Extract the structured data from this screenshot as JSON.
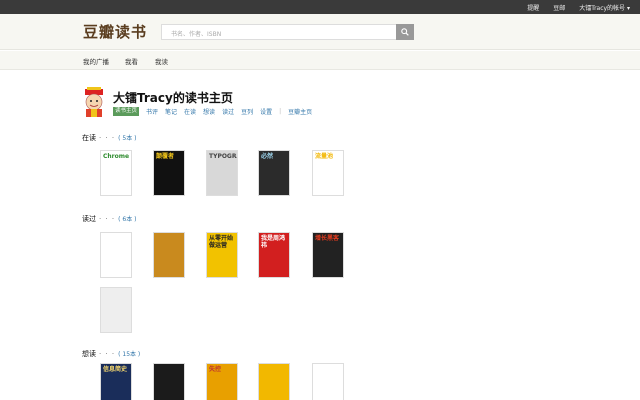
{
  "topbar": {
    "links": [
      "提醒",
      "豆邮"
    ],
    "account_label": "大镭Tracy的帐号",
    "account_caret": "▾"
  },
  "header": {
    "logo": "豆瓣读书",
    "search_placeholder": "书名、作者、ISBN",
    "search_icon": "search-icon"
  },
  "nav": {
    "items": [
      "我的广播",
      "我看",
      "我读"
    ]
  },
  "profile": {
    "title": "大镭Tracy的读书主页",
    "badge": "读书主页",
    "links": [
      "书评",
      "笔记",
      "在读",
      "想读",
      "读过",
      "豆列",
      "设置"
    ],
    "separator": "|",
    "extra_link": "豆瓣主页"
  },
  "sections": [
    {
      "name": "在读",
      "dots": "· · ·",
      "count": "( 5本 )",
      "books": [
        {
          "cover_text": "Chrome",
          "color": "#ffffff",
          "accent": "#2e8b2e"
        },
        {
          "cover_text": "颠覆者",
          "color": "#111111",
          "accent": "#f0c419"
        },
        {
          "cover_text": "TYPOGRAPHY",
          "color": "#d8d8d8",
          "accent": "#444444"
        },
        {
          "cover_text": "必然",
          "color": "#2b2b2b",
          "accent": "#9ad0e8"
        },
        {
          "cover_text": "流量池",
          "color": "#ffffff",
          "accent": "#f2b705"
        }
      ]
    },
    {
      "name": "读过",
      "dots": "· · ·",
      "count": "( 6本 )",
      "books": [
        {
          "cover_text": "",
          "color": "#ffffff",
          "accent": "#d33"
        },
        {
          "cover_text": "",
          "color": "#c98a1e",
          "accent": "#8a5a10"
        },
        {
          "cover_text": "从零开始做运营",
          "color": "#f2c200",
          "accent": "#222222"
        },
        {
          "cover_text": "我是周鸿祎",
          "color": "#d21f1f",
          "accent": "#ffffff"
        },
        {
          "cover_text": "增长黑客",
          "color": "#222222",
          "accent": "#e23b1f"
        },
        {
          "cover_text": "",
          "color": "#eeeeee",
          "accent": "#111111"
        }
      ]
    },
    {
      "name": "想读",
      "dots": "· · ·",
      "count": "( 15本 )",
      "books": [
        {
          "cover_text": "信息简史",
          "color": "#1a2d5a",
          "accent": "#f5d76e"
        },
        {
          "cover_text": "",
          "color": "#1b1b1b",
          "accent": "#ffffff"
        },
        {
          "cover_text": "失控",
          "color": "#e8a000",
          "accent": "#c0392b"
        },
        {
          "cover_text": "",
          "color": "#f2b800",
          "accent": "#222222"
        },
        {
          "cover_text": "",
          "color": "#ffffff",
          "accent": "#e8a000"
        }
      ]
    }
  ]
}
